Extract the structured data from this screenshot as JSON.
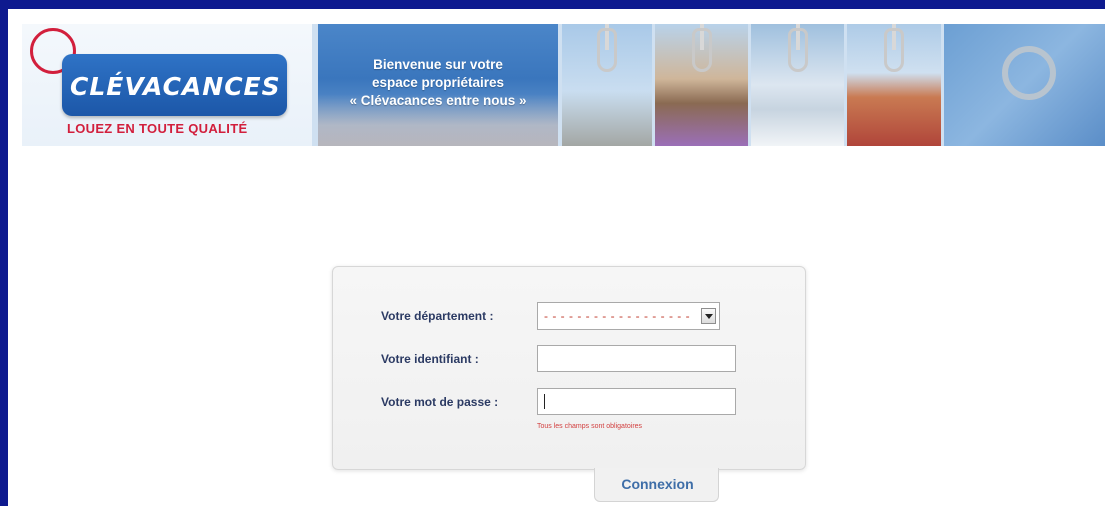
{
  "banner": {
    "logo_text": "CLÉVACANCES",
    "logo_tagline": "LOUEZ EN TOUTE QUALITÉ",
    "welcome_line1": "Bienvenue sur votre",
    "welcome_line2": "espace propriétaires",
    "welcome_line3": "« Clévacances entre nous »"
  },
  "form": {
    "department_label": "Votre département :",
    "department_value": "- - - - - - - - - - - - - - - - - -",
    "identifier_label": "Votre identifiant :",
    "identifier_value": "",
    "password_label": "Votre mot de passe :",
    "password_value": "",
    "required_note": "Tous les champs sont obligatoires",
    "submit_label": "Connexion"
  },
  "colors": {
    "frame": "#0e1a8f",
    "brand_blue": "#1c57a8",
    "brand_red": "#d21f3c",
    "label_text": "#2b3a63",
    "link_blue": "#3e6ea8"
  },
  "icons": {
    "select_arrow": "chevron-down-icon"
  }
}
